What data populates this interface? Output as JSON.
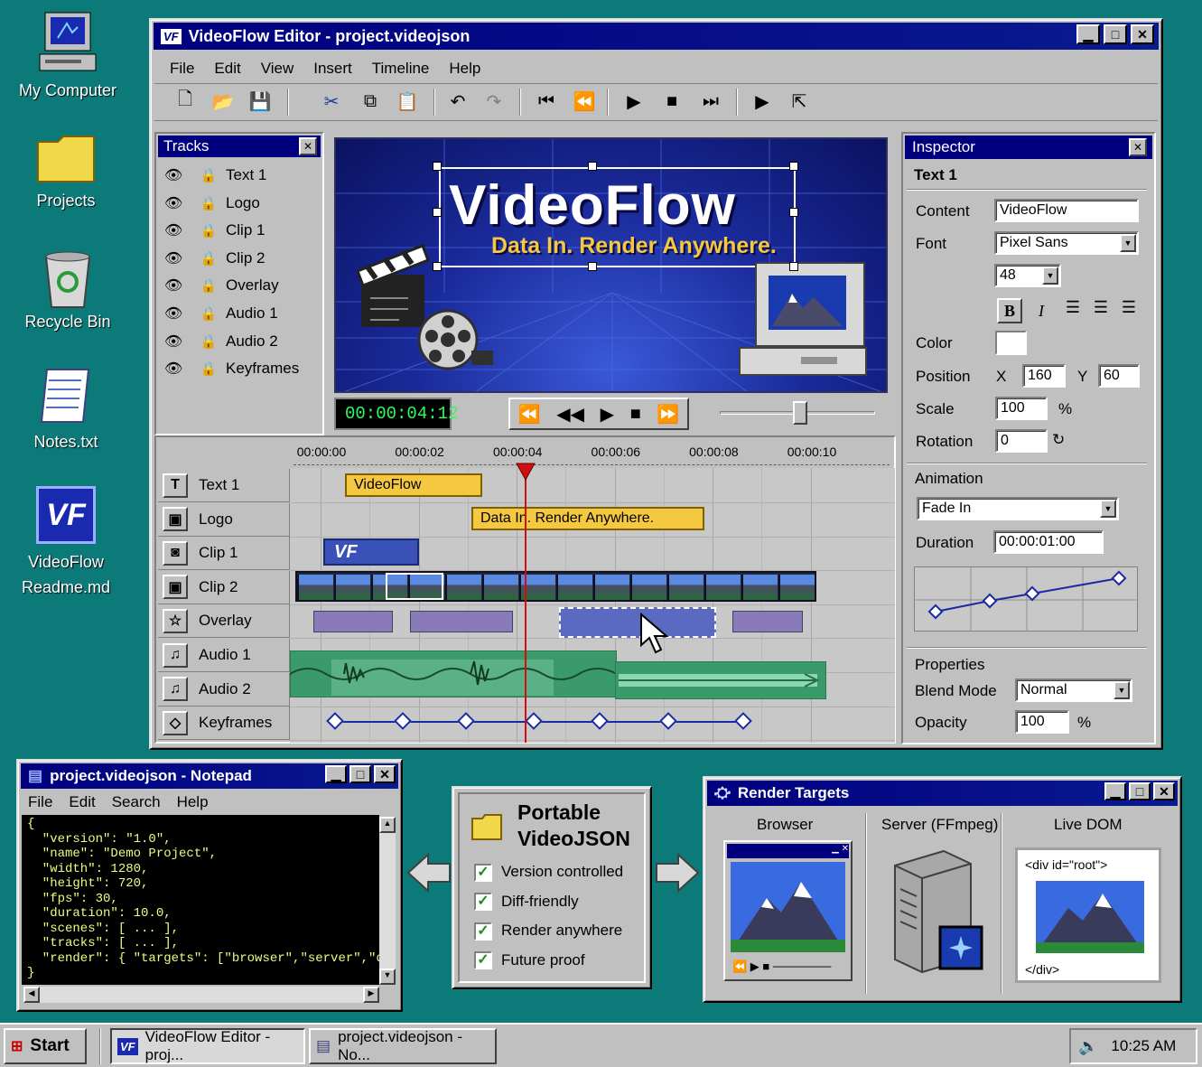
{
  "desktop": {
    "icons": [
      {
        "label": "My Computer"
      },
      {
        "label": "Projects"
      },
      {
        "label": "Recycle Bin"
      },
      {
        "label": "Notes.txt"
      },
      {
        "label": "VideoFlow\nReadme.md"
      }
    ]
  },
  "editor": {
    "title": "VideoFlow Editor - project.videojson",
    "app_badge": "VF",
    "menu": [
      "File",
      "Edit",
      "View",
      "Insert",
      "Timeline",
      "Help"
    ],
    "tracks_panel": {
      "title": "Tracks",
      "items": [
        "Text 1",
        "Logo",
        "Clip 1",
        "Clip 2",
        "Overlay",
        "Audio 1",
        "Audio 2",
        "Keyframes"
      ]
    },
    "preview": {
      "headline": "VideoFlow",
      "tagline": "Data In. Render Anywhere.",
      "timecode": "00:00:04:12"
    },
    "timeline": {
      "ticks": [
        "00:00:00",
        "00:00:02",
        "00:00:04",
        "00:00:06",
        "00:00:08",
        "00:00:10"
      ],
      "rows": [
        {
          "label": "Text 1",
          "icon": "T"
        },
        {
          "label": "Logo",
          "icon": "▣"
        },
        {
          "label": "Clip 1",
          "icon": "◙"
        },
        {
          "label": "Clip 2",
          "icon": "▣"
        },
        {
          "label": "Overlay",
          "icon": "☆"
        },
        {
          "label": "Audio 1",
          "icon": "♫"
        },
        {
          "label": "Audio 2",
          "icon": "♫"
        },
        {
          "label": "Keyframes",
          "icon": "◇"
        }
      ],
      "clip_text1": "VideoFlow",
      "clip_text2": "Data In. Render Anywhere.",
      "clip_logo": "VF"
    },
    "inspector": {
      "title": "Inspector",
      "selected": "Text 1",
      "content_label": "Content",
      "content_value": "VideoFlow",
      "font_label": "Font",
      "font_value": "Pixel Sans",
      "size_value": "48",
      "bold": "B",
      "italic": "I",
      "color_label": "Color",
      "position_label": "Position",
      "x_label": "X",
      "x_value": "160",
      "y_label": "Y",
      "y_value": "60",
      "scale_label": "Scale",
      "scale_value": "100",
      "scale_unit": "%",
      "rotation_label": "Rotation",
      "rotation_value": "0",
      "animation_label": "Animation",
      "animation_value": "Fade In",
      "duration_label": "Duration",
      "duration_value": "00:00:01:00",
      "properties_label": "Properties",
      "blend_label": "Blend Mode",
      "blend_value": "Normal",
      "opacity_label": "Opacity",
      "opacity_value": "100",
      "opacity_unit": "%"
    }
  },
  "notepad": {
    "title": "project.videojson - Notepad",
    "menu": [
      "File",
      "Edit",
      "Search",
      "Help"
    ],
    "lines": [
      "{",
      "  \"version\": \"1.0\",",
      "  \"name\": \"Demo Project\",",
      "  \"width\": 1280,",
      "  \"height\": 720,",
      "  \"fps\": 30,",
      "  \"duration\": 10.0,",
      "  \"scenes\": [ ... ],",
      "  \"tracks\": [ ... ],",
      "  \"render\": { \"targets\": [\"browser\",\"server\",\"dom\"] }",
      "}"
    ]
  },
  "portable": {
    "title_line1": "Portable",
    "title_line2": "VideoJSON",
    "items": [
      "Version controlled",
      "Diff-friendly",
      "Render anywhere",
      "Future proof"
    ]
  },
  "render": {
    "title": "Render Targets",
    "targets": [
      "Browser",
      "Server (FFmpeg)",
      "Live DOM"
    ],
    "dom_open": "<div id=\"root\">",
    "dom_close": "</div>"
  },
  "taskbar": {
    "start": "Start",
    "tasks": [
      "VideoFlow Editor - proj...",
      "project.videojson - No..."
    ],
    "clock": "10:25 AM"
  },
  "colors": {
    "desktop": "#0d7a7a",
    "titlebar": "#00007f",
    "clip_yellow": "#f5c842",
    "overlay": "#8a7ab8",
    "audio": "#3a9a6a",
    "playhead": "#d01010"
  }
}
